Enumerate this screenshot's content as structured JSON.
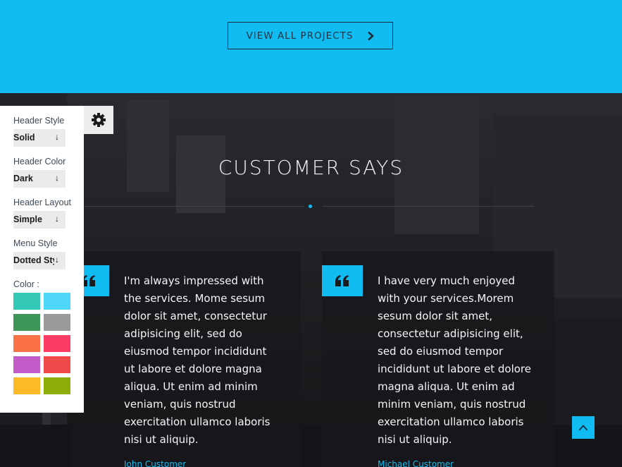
{
  "projects_button": {
    "label": "VIEW ALL PROJECTS",
    "icon": "chevron-right-icon"
  },
  "testimonials": {
    "title": "CUSTOMER SAYS",
    "items": [
      {
        "text": "I'm always impressed with the services. Mome sesum dolor sit amet, consectetur adipisicing elit, sed do eiusmod tempor incididunt ut labore et dolore magna aliqua. Ut enim ad minim veniam, quis nostrud exercitation ullamco laboris nisi ut aliquip.",
        "author": "John  Customer"
      },
      {
        "text": "I have very much enjoyed with your services.Morem sesum dolor sit amet, consectetur adipisicing elit, sed do eiusmod tempor incididunt ut labore et dolore magna aliqua. Ut enim ad minim veniam, quis nostrud exercitation ullamco laboris nisi ut aliquip.",
        "author": "Michael  Customer"
      }
    ]
  },
  "style_panel": {
    "gear_icon": "gear-icon",
    "header_style": {
      "label": "Header Style",
      "value": "Solid"
    },
    "header_color": {
      "label": "Header Color",
      "value": "Dark"
    },
    "header_layout": {
      "label": "Header Layout",
      "value": "Simple"
    },
    "menu_style": {
      "label": "Menu Style",
      "value": "Dotted Style"
    },
    "color_label": "Color :",
    "swatches": [
      "#33c9b6",
      "#4fd7f8",
      "#3f9659",
      "#9a9a9a",
      "#fc7248",
      "#fd3c63",
      "#c35cc9",
      "#ef4949",
      "#fdba28",
      "#8cad06"
    ]
  },
  "scroll_top": {
    "icon": "chevron-up-icon"
  },
  "colors": {
    "accent": "#10bcf1",
    "dark": "#1a1b1e"
  }
}
